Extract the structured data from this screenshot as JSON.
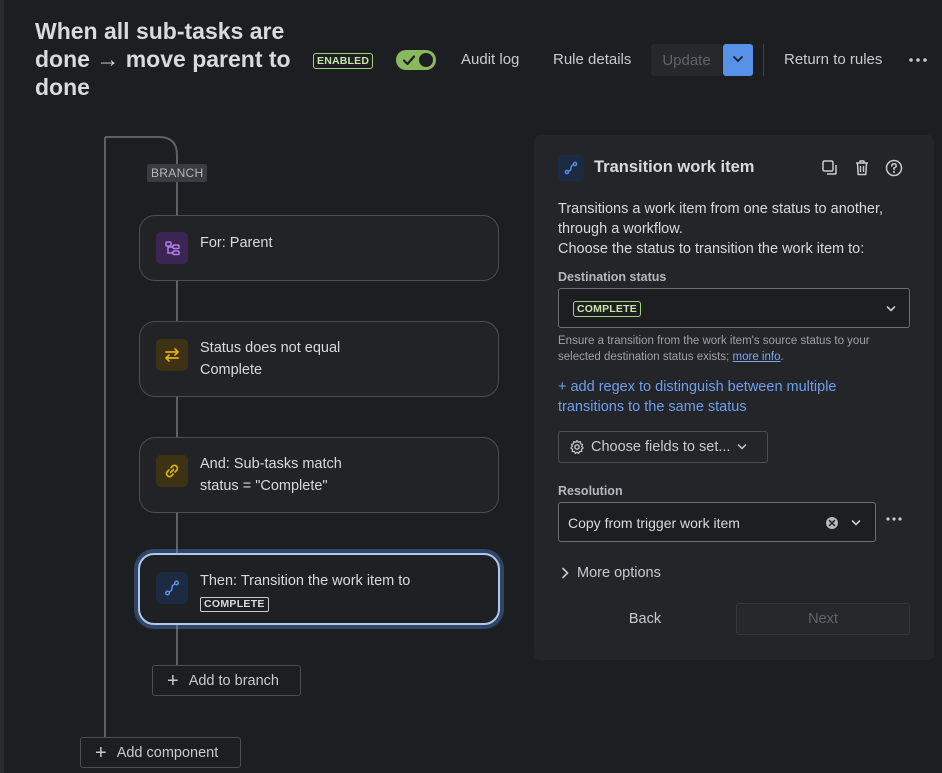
{
  "header": {
    "title": "When all sub-tasks are done → move parent to done",
    "status_badge": "ENABLED",
    "toggle_on": true,
    "audit_log": "Audit log",
    "rule_details": "Rule details",
    "update": "Update",
    "return_to_rules": "Return to rules",
    "more": "···"
  },
  "tree": {
    "branch_tag": "BRANCH",
    "cards": [
      {
        "text": "For: Parent",
        "icon": "branch-hierarchy-icon",
        "color": "#b37feb"
      },
      {
        "line1": "Status does not equal",
        "line2": "Complete",
        "icon": "swap-arrows-icon",
        "color": "#e2b203"
      },
      {
        "line1": "And: Sub-tasks match",
        "line2": "status = \"Complete\"",
        "icon": "link-icon",
        "color": "#e2b203"
      },
      {
        "line1": "Then: Transition the work item to",
        "status": "COMPLETE",
        "icon": "transition-icon",
        "color": "#5892e8"
      }
    ],
    "add_to_branch": "Add to branch",
    "add_component": "Add component"
  },
  "panel": {
    "title": "Transition work item",
    "description_line1": "Transitions a work item from one status to another, through a workflow.",
    "description_line2": "Choose the status to transition the work item to:",
    "destination_label": "Destination status",
    "destination_value": "COMPLETE",
    "helper_text": "Ensure a transition from the work item's source status to your selected destination status exists;",
    "helper_link": "more info",
    "regex_link": "+ add regex to distinguish between multiple transitions to the same status",
    "choose_fields": "Choose fields to set...",
    "resolution_label": "Resolution",
    "resolution_value": "Copy from trigger work item",
    "more_options": "More options",
    "back": "Back",
    "next": "Next"
  },
  "colors": {
    "accent_blue": "#5892e8",
    "enabled_green": "#8ab85f",
    "link_blue": "#6d9ff0"
  }
}
